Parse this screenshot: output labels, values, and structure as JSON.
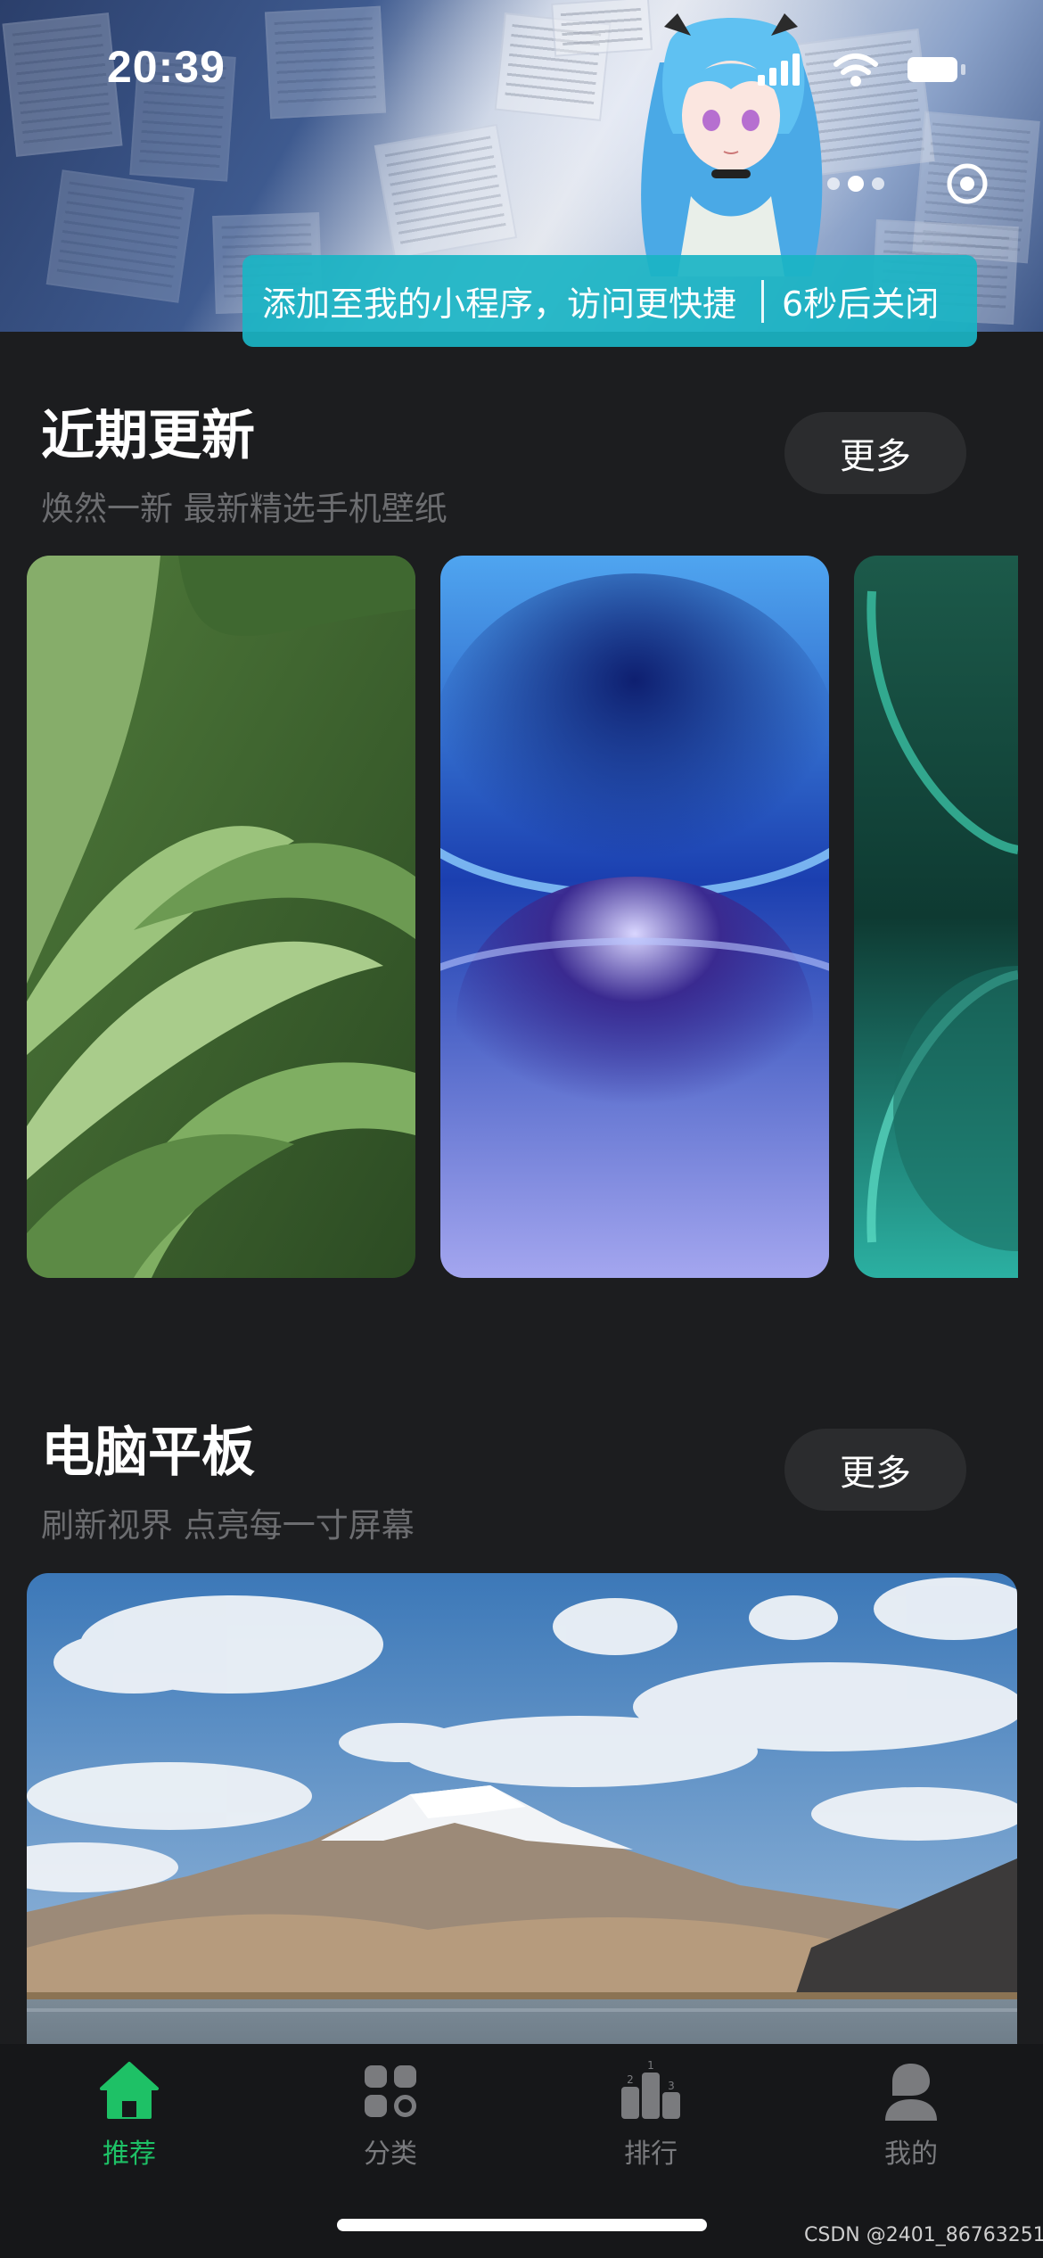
{
  "status_bar": {
    "time": "20:39",
    "icons": [
      "signal-icon",
      "wifi-icon",
      "battery-icon"
    ]
  },
  "toast": {
    "message": "添加至我的小程序，访问更快捷",
    "close_text": "6秒后关闭"
  },
  "sections": [
    {
      "title": "近期更新",
      "subtitle": "焕然一新 最新精选手机壁纸",
      "more_label": "更多",
      "items": [
        "green-fabric-wallpaper",
        "blue-sphere-wallpaper",
        "teal-sphere-wallpaper"
      ]
    },
    {
      "title": "电脑平板",
      "subtitle": "刷新视界 点亮每一寸屏幕",
      "more_label": "更多",
      "items": [
        "snow-mountain-lake-wallpaper"
      ]
    }
  ],
  "tabbar": {
    "tabs": [
      {
        "label": "推荐",
        "icon": "home-icon",
        "active": true
      },
      {
        "label": "分类",
        "icon": "category-icon",
        "active": false
      },
      {
        "label": "排行",
        "icon": "ranking-podium-icon",
        "active": false
      },
      {
        "label": "我的",
        "icon": "profile-icon",
        "active": false
      }
    ],
    "ranking_digits": [
      "1",
      "2",
      "3"
    ]
  },
  "colors": {
    "background": "#1c1d1f",
    "accent": "#1ec166",
    "toast": "#1ab4c4",
    "button": "#2b2c2e",
    "muted_text": "#6c6d70"
  },
  "watermark": "CSDN @2401_86763251"
}
